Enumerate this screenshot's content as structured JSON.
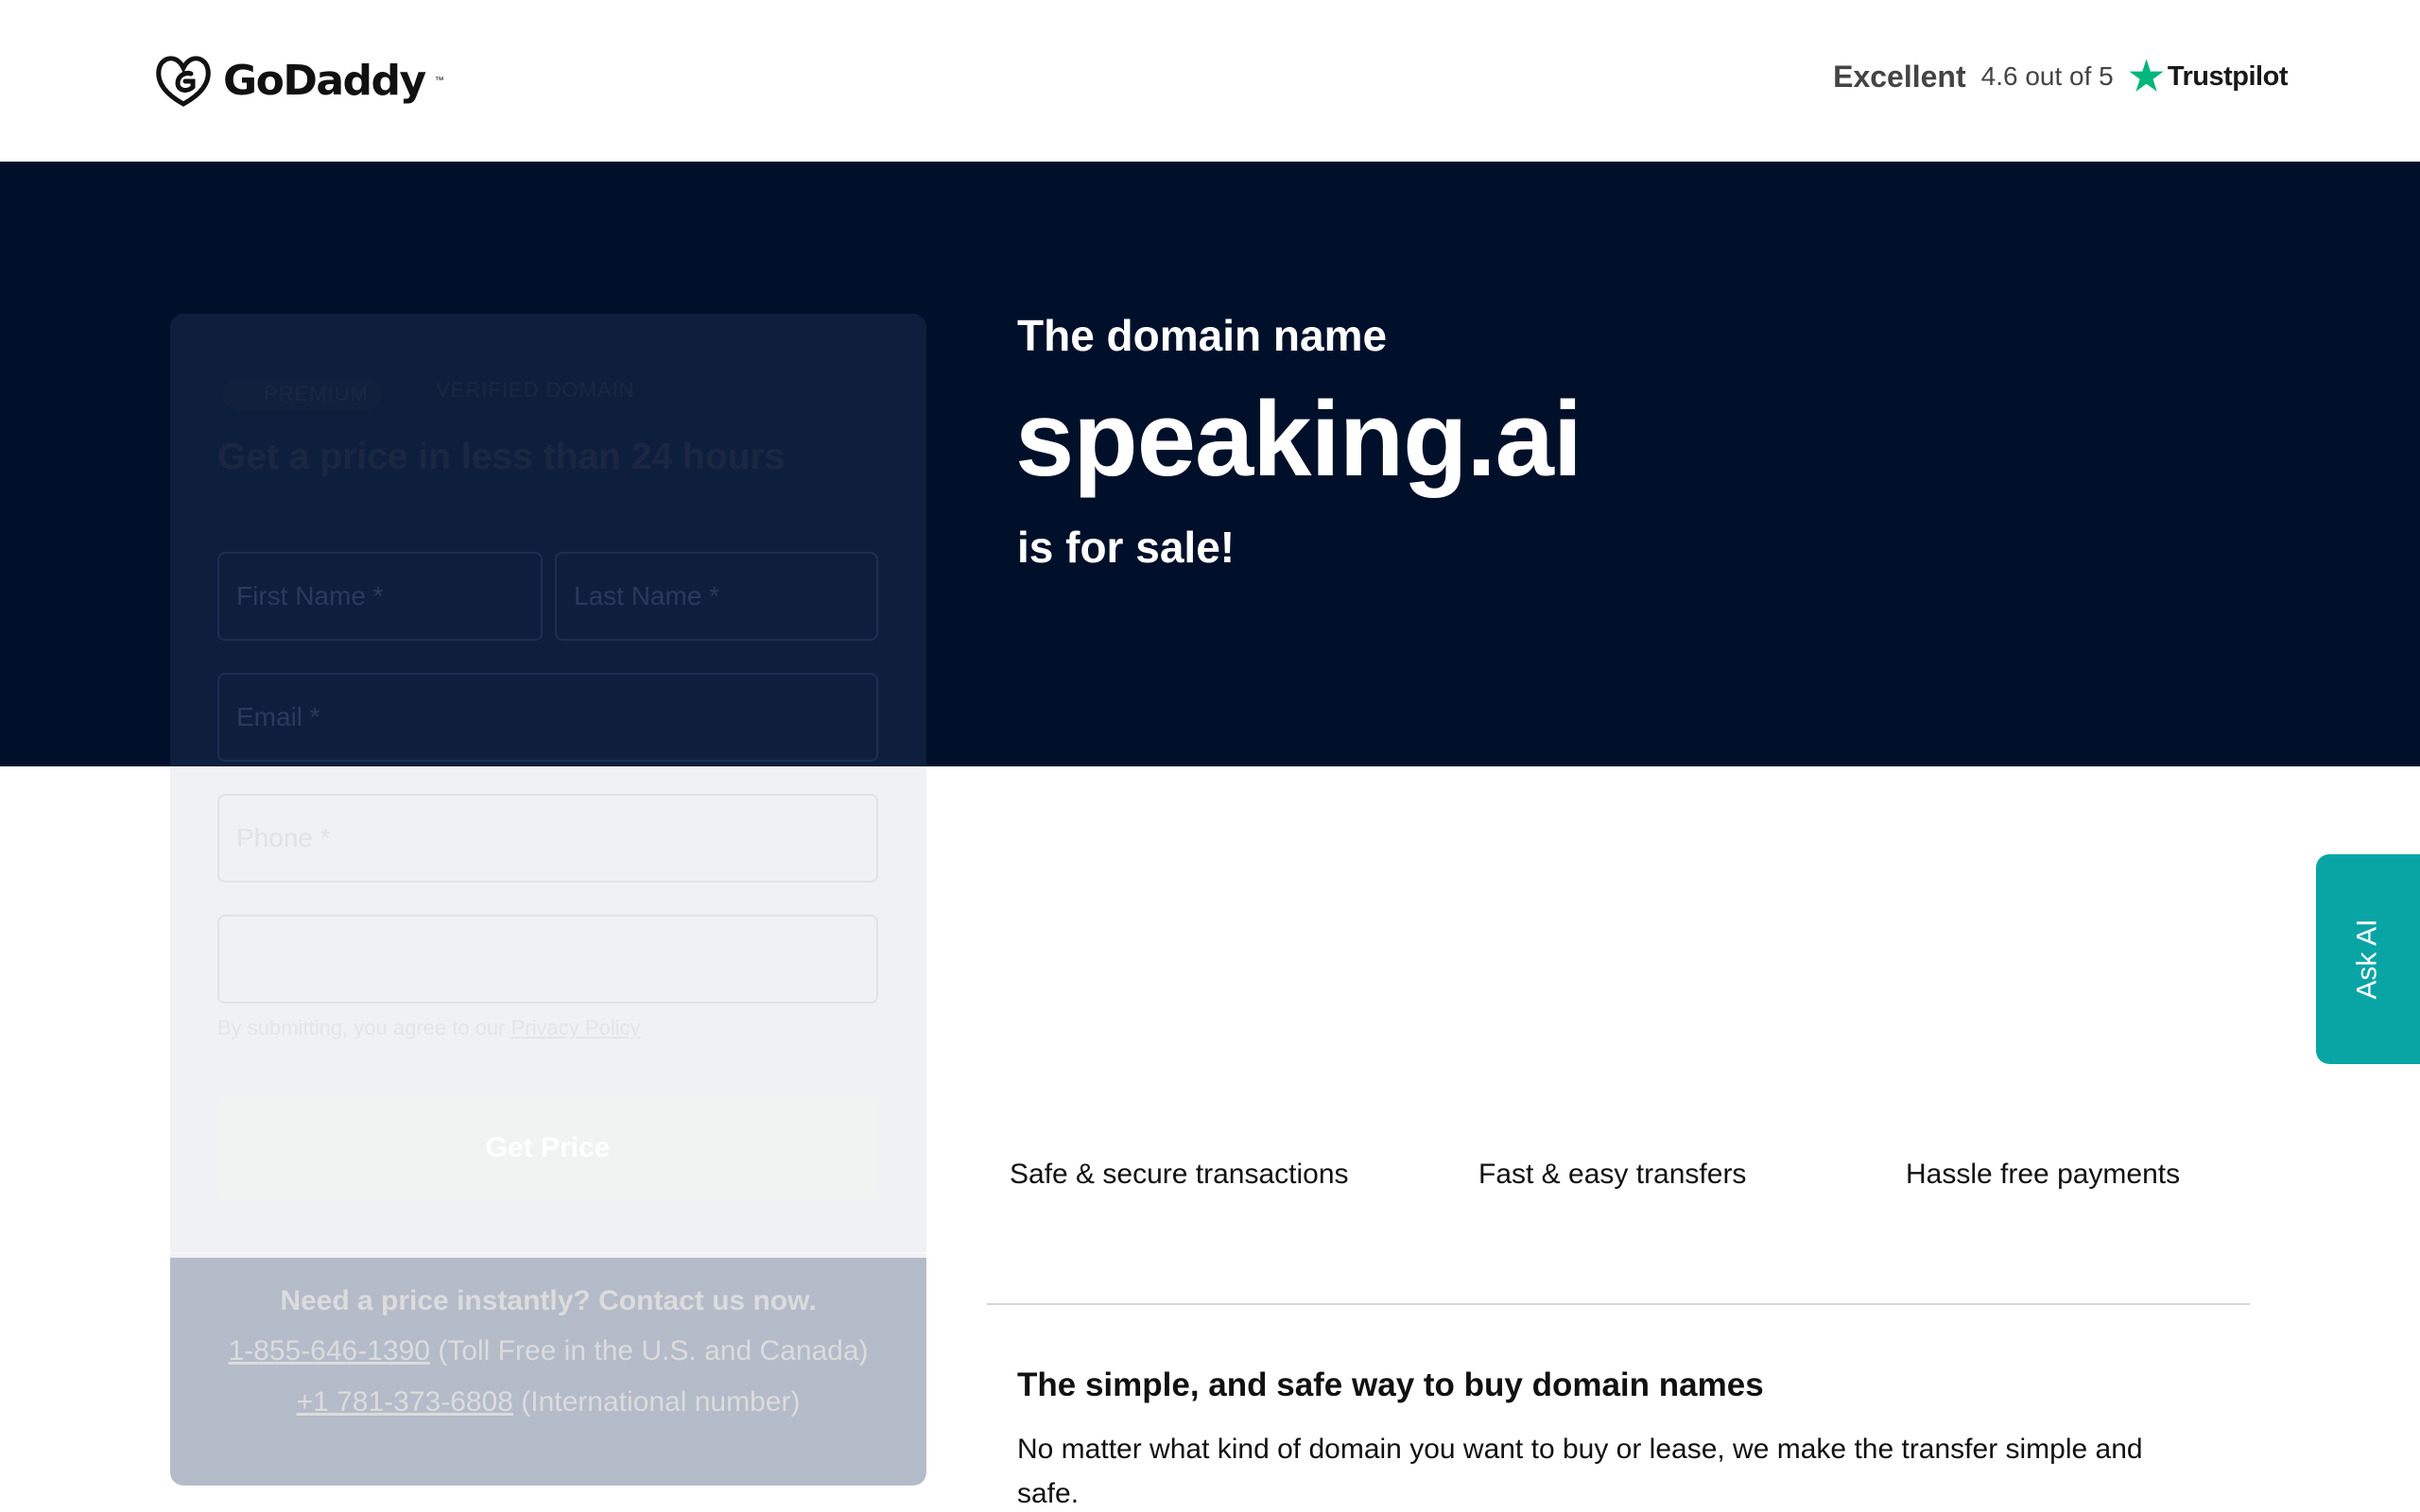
{
  "header": {
    "logo_text": "GoDaddy",
    "logo_tm": "™",
    "trustpilot": {
      "rating_word": "Excellent",
      "score": "4.6 out of 5",
      "brand": "Trustpilot"
    }
  },
  "hero": {
    "line1": "The domain name",
    "domain": "speaking.ai",
    "line3": "is for sale!"
  },
  "form": {
    "badge_premium": "PREMIUM",
    "badge_verified": "VERIFIED DOMAIN",
    "title": "Get a price in less than 24 hours",
    "first_name_placeholder": "First Name *",
    "last_name_placeholder": "Last Name *",
    "email_placeholder": "Email *",
    "phone_placeholder": "Phone *",
    "terms_prefix": "By submitting, you agree to our",
    "privacy_link": "Privacy Policy",
    "submit_label": "Get Price"
  },
  "contact": {
    "title": "Need a price instantly? Contact us now.",
    "tollfree_number": "1-855-646-1390",
    "tollfree_note": "(Toll Free in the U.S. and Canada)",
    "intl_number": "+1 781-373-6808",
    "intl_note": "(International number)"
  },
  "features": [
    "Safe & secure transactions",
    "Fast & easy transfers",
    "Hassle free payments"
  ],
  "info": {
    "title": "The simple, and safe way to buy domain names",
    "body": "No matter what kind of domain you want to buy or lease, we make the transfer simple and safe."
  },
  "ask_ai": "Ask AI",
  "colors": {
    "hero_bg": "#00102a",
    "accent_teal": "#09a5a5",
    "trustpilot_green": "#00b67a"
  }
}
